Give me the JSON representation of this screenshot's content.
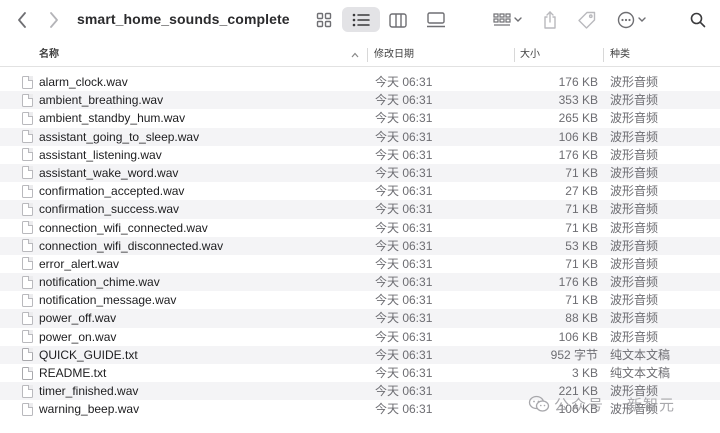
{
  "window": {
    "title": "smart_home_sounds_complete"
  },
  "toolbar": {
    "back_icon": "chevron-left-icon",
    "forward_icon": "chevron-right-icon",
    "views": [
      "icon-grid-icon",
      "list-view-icon",
      "column-view-icon",
      "gallery-view-icon"
    ],
    "selected_view": "list-view-icon"
  },
  "columns": {
    "name": "名称",
    "date": "修改日期",
    "size": "大小",
    "kind": "种类"
  },
  "files": [
    {
      "name": "alarm_clock.wav",
      "date": "今天 06:31",
      "size": "176 KB",
      "kind": "波形音频"
    },
    {
      "name": "ambient_breathing.wav",
      "date": "今天 06:31",
      "size": "353 KB",
      "kind": "波形音频"
    },
    {
      "name": "ambient_standby_hum.wav",
      "date": "今天 06:31",
      "size": "265 KB",
      "kind": "波形音频"
    },
    {
      "name": "assistant_going_to_sleep.wav",
      "date": "今天 06:31",
      "size": "106 KB",
      "kind": "波形音频"
    },
    {
      "name": "assistant_listening.wav",
      "date": "今天 06:31",
      "size": "176 KB",
      "kind": "波形音频"
    },
    {
      "name": "assistant_wake_word.wav",
      "date": "今天 06:31",
      "size": "71 KB",
      "kind": "波形音频"
    },
    {
      "name": "confirmation_accepted.wav",
      "date": "今天 06:31",
      "size": "27 KB",
      "kind": "波形音频"
    },
    {
      "name": "confirmation_success.wav",
      "date": "今天 06:31",
      "size": "71 KB",
      "kind": "波形音频"
    },
    {
      "name": "connection_wifi_connected.wav",
      "date": "今天 06:31",
      "size": "71 KB",
      "kind": "波形音频"
    },
    {
      "name": "connection_wifi_disconnected.wav",
      "date": "今天 06:31",
      "size": "53 KB",
      "kind": "波形音频"
    },
    {
      "name": "error_alert.wav",
      "date": "今天 06:31",
      "size": "71 KB",
      "kind": "波形音频"
    },
    {
      "name": "notification_chime.wav",
      "date": "今天 06:31",
      "size": "176 KB",
      "kind": "波形音频"
    },
    {
      "name": "notification_message.wav",
      "date": "今天 06:31",
      "size": "71 KB",
      "kind": "波形音频"
    },
    {
      "name": "power_off.wav",
      "date": "今天 06:31",
      "size": "88 KB",
      "kind": "波形音频"
    },
    {
      "name": "power_on.wav",
      "date": "今天 06:31",
      "size": "106 KB",
      "kind": "波形音频"
    },
    {
      "name": "QUICK_GUIDE.txt",
      "date": "今天 06:31",
      "size": "952 字节",
      "kind": "纯文本文稿"
    },
    {
      "name": "README.txt",
      "date": "今天 06:31",
      "size": "3 KB",
      "kind": "纯文本文稿"
    },
    {
      "name": "timer_finished.wav",
      "date": "今天 06:31",
      "size": "221 KB",
      "kind": "波形音频"
    },
    {
      "name": "warning_beep.wav",
      "date": "今天 06:31",
      "size": "106 KB",
      "kind": "波形音频"
    }
  ],
  "watermark": {
    "text": "公众号",
    "text2": "新智元"
  },
  "colors": {
    "selected_view_bg": "#e3e3e6",
    "alt_row": "#f4f4f6",
    "secondary_text": "#6d6d72"
  }
}
